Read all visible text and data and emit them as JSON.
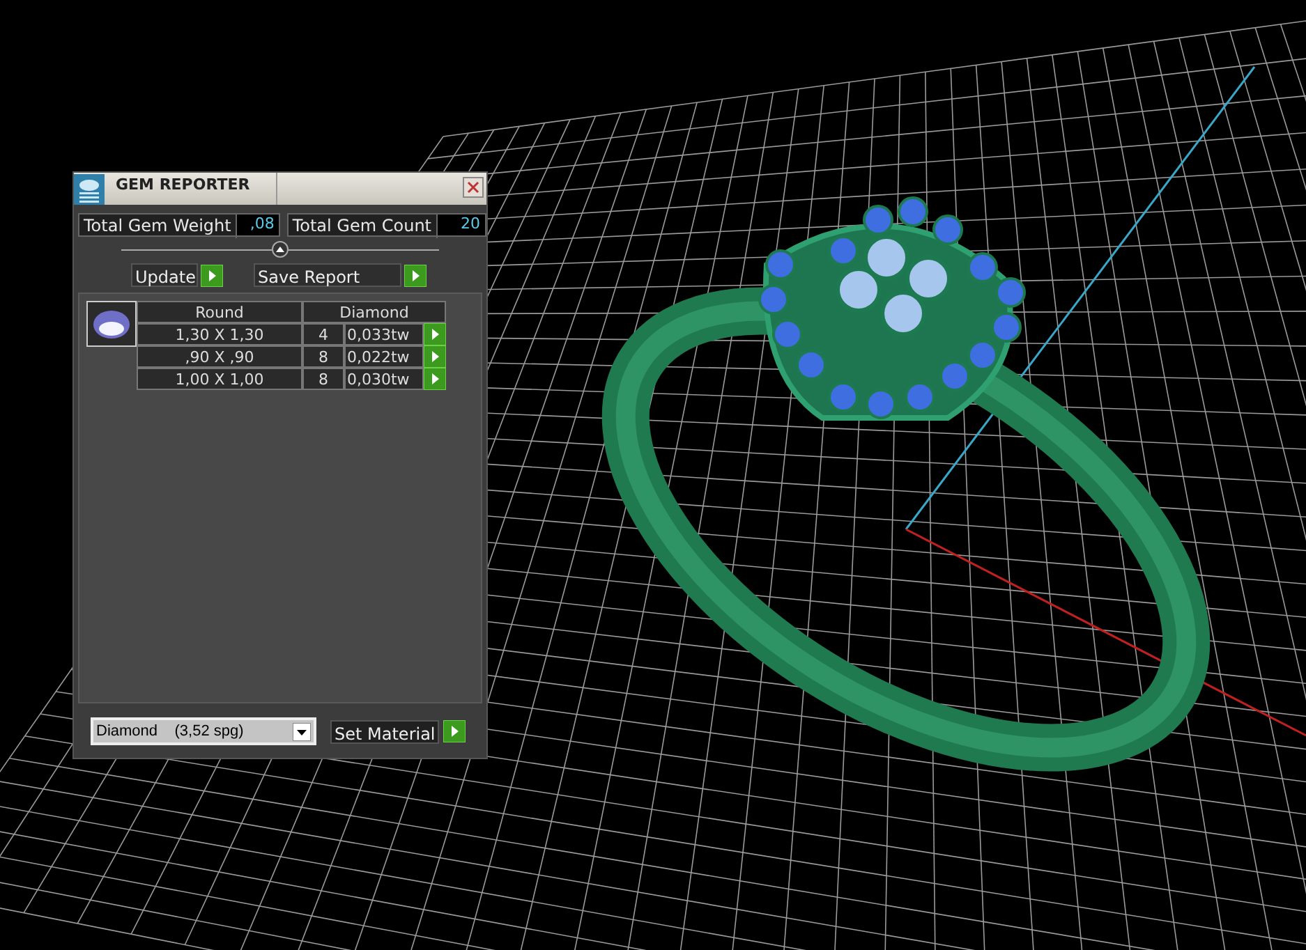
{
  "window": {
    "title": "GEM REPORTER"
  },
  "totals": [
    {
      "label": "Total Gem Weight",
      "value": ",08"
    },
    {
      "label": "Total Gem Count",
      "value": "20"
    }
  ],
  "buttons": [
    {
      "label": "Update"
    },
    {
      "label": "Save Report"
    }
  ],
  "table": {
    "columns": [
      "Round",
      "Diamond"
    ],
    "rows": [
      {
        "size": "1,30 X 1,30",
        "count": "4",
        "weight": "0,033tw"
      },
      {
        "size": ",90 X ,90",
        "count": "8",
        "weight": "0,022tw"
      },
      {
        "size": "1,00 X 1,00",
        "count": "8",
        "weight": "0,030tw"
      }
    ]
  },
  "material": {
    "value": "Diamond    (3,52 spg)",
    "button": "Set Material"
  }
}
